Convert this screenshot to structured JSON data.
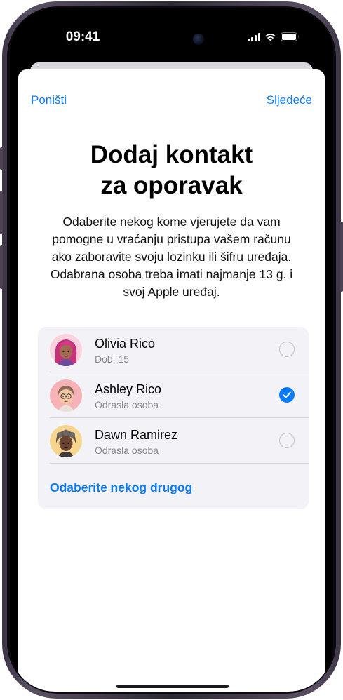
{
  "status": {
    "time": "09:41"
  },
  "nav": {
    "cancel_label": "Poništi",
    "next_label": "Sljedeće"
  },
  "header": {
    "title_line1": "Dodaj kontakt",
    "title_line2": "za oporavak"
  },
  "description": [
    "Odaberite nekog kome vjerujete da vam",
    "pomogne u vraćanju pristupa vašem računu",
    "ako zaboravite svoju lozinku ili šifru uređaja.",
    "Odabrana osoba treba imati najmanje 13 g. i",
    "svoj Apple uređaj."
  ],
  "contacts": [
    {
      "name": "Olivia Rico",
      "subtitle": "Dob: 15",
      "selected": false,
      "avatar_icon": "memoji-olivia-icon",
      "avatar_bg": "#e7569a"
    },
    {
      "name": "Ashley Rico",
      "subtitle": "Odrasla osoba",
      "selected": true,
      "avatar_icon": "memoji-ashley-icon",
      "avatar_bg": "#f7b2b7"
    },
    {
      "name": "Dawn Ramirez",
      "subtitle": "Odrasla osoba",
      "selected": false,
      "avatar_icon": "memoji-dawn-icon",
      "avatar_bg": "#f6d58e"
    }
  ],
  "choose_other_label": "Odaberite nekog drugog",
  "colors": {
    "accent": "#0a7aff",
    "card_bg": "#f2f2f7",
    "secondary_text": "#8a8a8e"
  }
}
